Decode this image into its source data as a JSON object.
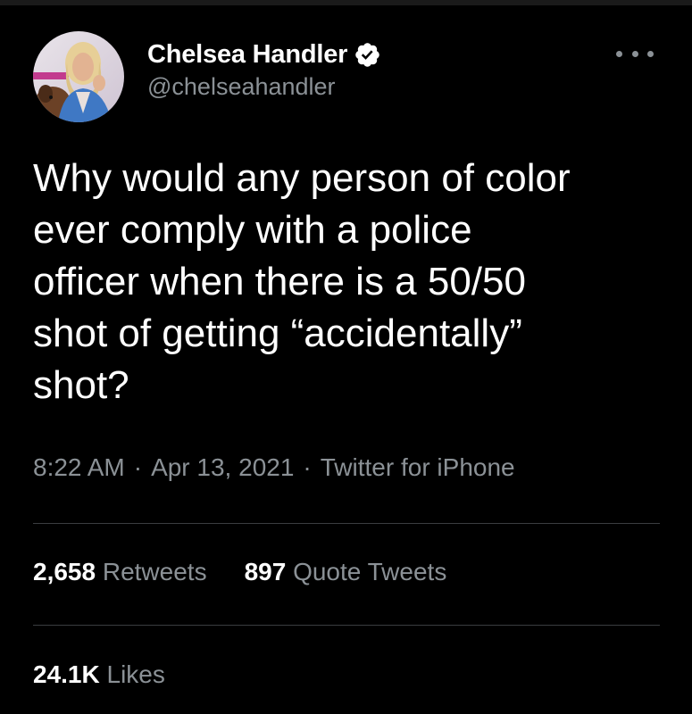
{
  "tweet": {
    "author": {
      "display_name": "Chelsea Handler",
      "handle": "@chelseahandler",
      "verified": true,
      "avatar": "profile-photo"
    },
    "more_icon": "more-horizontal-icon",
    "text_lines": [
      "Why would any person of color",
      "ever comply with a police",
      "officer when there is a 50/50",
      "shot of getting “accidentally”",
      "shot?"
    ],
    "time": "8:22 AM",
    "date": "Apr 13, 2021",
    "source": "Twitter for iPhone",
    "separator": "·",
    "stats": {
      "retweets": {
        "count": "2,658",
        "label": "Retweets"
      },
      "quote_tweets": {
        "count": "897",
        "label": "Quote Tweets"
      },
      "likes": {
        "count": "24.1K",
        "label": "Likes"
      }
    }
  },
  "colors": {
    "background": "#000000",
    "primary_text": "#ffffff",
    "secondary_text": "#8b9196",
    "divider": "#3a3d40"
  }
}
